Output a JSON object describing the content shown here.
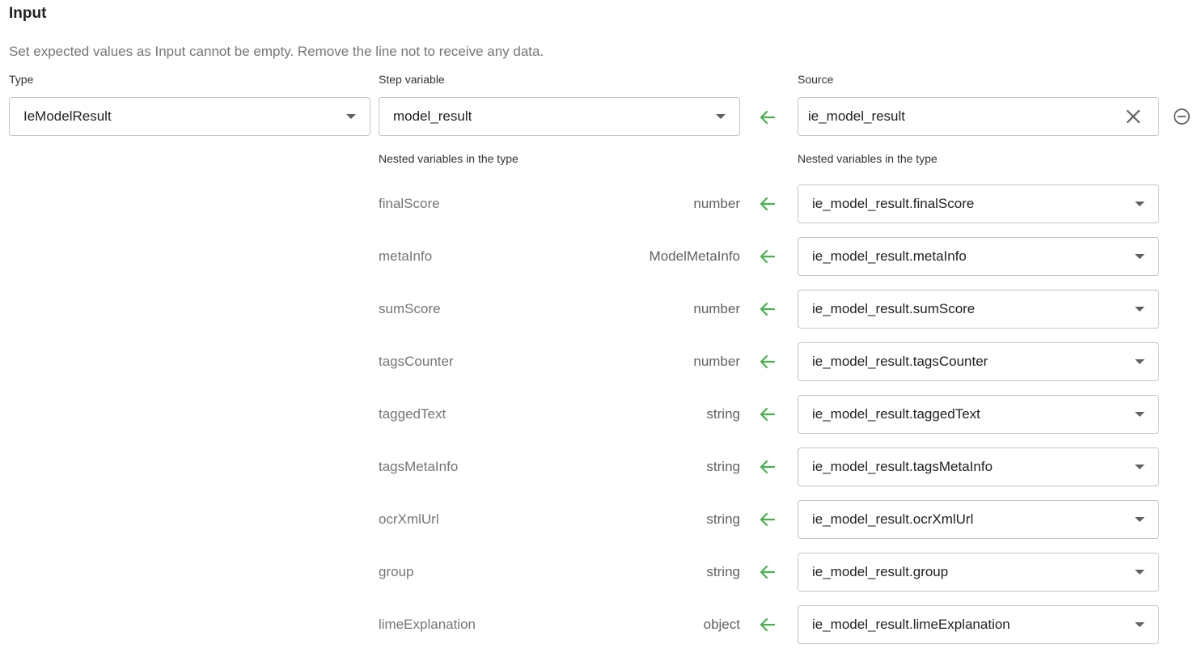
{
  "section": {
    "title": "Input",
    "hint": "Set expected values as Input cannot be empty. Remove the line not to receive any data."
  },
  "columns": {
    "type_label": "Type",
    "step_variable_label": "Step variable",
    "source_label": "Source"
  },
  "main_row": {
    "type_value": "IeModelResult",
    "step_variable_value": "model_result",
    "source_value": "ie_model_result"
  },
  "nested": {
    "left_label": "Nested variables in the type",
    "right_label": "Nested variables in the type",
    "rows": [
      {
        "name": "finalScore",
        "type": "number",
        "source": "ie_model_result.finalScore"
      },
      {
        "name": "metaInfo",
        "type": "ModelMetaInfo",
        "source": "ie_model_result.metaInfo"
      },
      {
        "name": "sumScore",
        "type": "number",
        "source": "ie_model_result.sumScore"
      },
      {
        "name": "tagsCounter",
        "type": "number",
        "source": "ie_model_result.tagsCounter"
      },
      {
        "name": "taggedText",
        "type": "string",
        "source": "ie_model_result.taggedText"
      },
      {
        "name": "tagsMetaInfo",
        "type": "string",
        "source": "ie_model_result.tagsMetaInfo"
      },
      {
        "name": "ocrXmlUrl",
        "type": "string",
        "source": "ie_model_result.ocrXmlUrl"
      },
      {
        "name": "group",
        "type": "string",
        "source": "ie_model_result.group"
      },
      {
        "name": "limeExplanation",
        "type": "object",
        "source": "ie_model_result.limeExplanation"
      }
    ]
  },
  "colors": {
    "arrow": "#4caf50",
    "border": "#c4c4c4",
    "muted_text": "#757575"
  },
  "icons": {
    "arrow": "arrow-left-icon",
    "dropdown": "chevron-down-icon",
    "clear": "close-icon",
    "remove": "remove-circle-icon"
  }
}
